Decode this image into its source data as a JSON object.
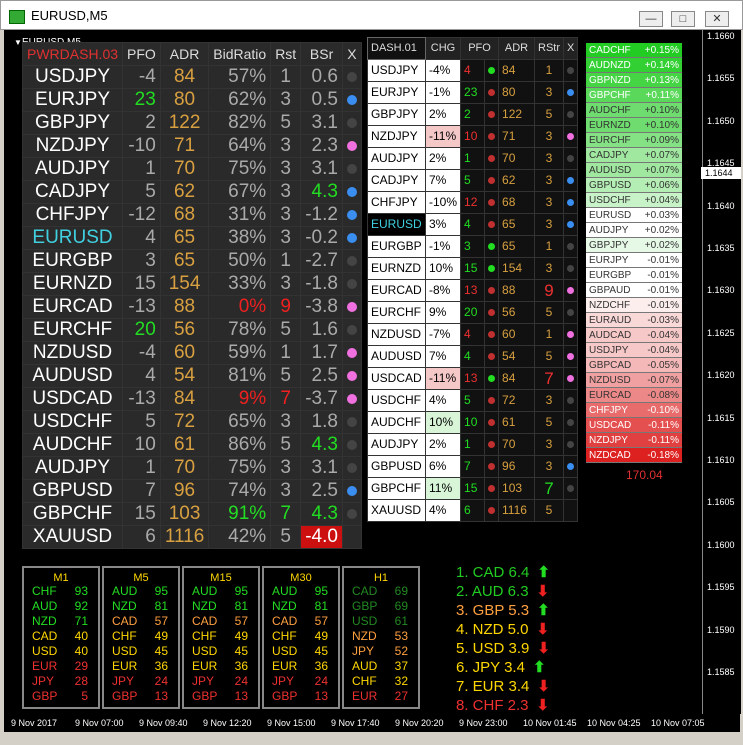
{
  "window": {
    "title": "EURUSD,M5",
    "chart_name": "EURUSD,M5"
  },
  "dash1": {
    "title": "PWRDASH.03",
    "headers": [
      "PFO",
      "ADR",
      "BidRatio",
      "Rst",
      "BSr",
      "X"
    ],
    "rows": [
      {
        "sym": "USDJPY",
        "pfo": "-4",
        "adr": "84",
        "bid": "57%",
        "rst": "1",
        "bsr": "0.6",
        "dot": "gray"
      },
      {
        "sym": "EURJPY",
        "pfo": "23",
        "pfo_color": "#22dd22",
        "adr": "80",
        "bid": "62%",
        "rst": "3",
        "bsr": "0.5",
        "dot": "blue"
      },
      {
        "sym": "GBPJPY",
        "pfo": "2",
        "adr": "122",
        "bid": "82%",
        "rst": "5",
        "bsr": "3.1",
        "dot": "gray"
      },
      {
        "sym": "NZDJPY",
        "pfo": "-10",
        "adr": "71",
        "bid": "64%",
        "rst": "3",
        "bsr": "2.3",
        "dot": "pink"
      },
      {
        "sym": "AUDJPY",
        "pfo": "1",
        "adr": "70",
        "bid": "75%",
        "rst": "3",
        "bsr": "3.1",
        "dot": "gray"
      },
      {
        "sym": "CADJPY",
        "pfo": "5",
        "adr": "62",
        "bid": "67%",
        "rst": "3",
        "bsr": "4.3",
        "bsr_color": "#22dd22",
        "dot": "blue"
      },
      {
        "sym": "CHFJPY",
        "pfo": "-12",
        "adr": "68",
        "bid": "31%",
        "rst": "3",
        "bsr": "-1.2",
        "dot": "blue"
      },
      {
        "sym": "EURUSD",
        "sym_color": "#40d0e0",
        "pfo": "4",
        "adr": "65",
        "bid": "38%",
        "rst": "3",
        "bsr": "-0.2",
        "dot": "blue"
      },
      {
        "sym": "EURGBP",
        "pfo": "3",
        "adr": "65",
        "bid": "50%",
        "rst": "1",
        "bsr": "-2.7",
        "dot": "gray"
      },
      {
        "sym": "EURNZD",
        "pfo": "15",
        "adr": "154",
        "bid": "33%",
        "rst": "3",
        "bsr": "-1.8",
        "dot": "gray"
      },
      {
        "sym": "EURCAD",
        "pfo": "-13",
        "adr": "88",
        "bid": "0%",
        "bid_color": "#ee2020",
        "rst": "9",
        "rst_color": "#ee2020",
        "bsr": "-3.8",
        "dot": "pink"
      },
      {
        "sym": "EURCHF",
        "pfo": "20",
        "pfo_color": "#22dd22",
        "adr": "56",
        "bid": "78%",
        "rst": "5",
        "bsr": "1.6",
        "dot": "gray"
      },
      {
        "sym": "NZDUSD",
        "pfo": "-4",
        "adr": "60",
        "bid": "59%",
        "rst": "1",
        "bsr": "1.7",
        "dot": "pink"
      },
      {
        "sym": "AUDUSD",
        "pfo": "4",
        "adr": "54",
        "bid": "81%",
        "rst": "5",
        "bsr": "2.5",
        "dot": "pink"
      },
      {
        "sym": "USDCAD",
        "pfo": "-13",
        "adr": "84",
        "bid": "9%",
        "bid_color": "#ee2020",
        "rst": "7",
        "rst_color": "#ee2020",
        "bsr": "-3.7",
        "dot": "pink"
      },
      {
        "sym": "USDCHF",
        "pfo": "5",
        "adr": "72",
        "bid": "65%",
        "rst": "3",
        "bsr": "1.8",
        "dot": "gray"
      },
      {
        "sym": "AUDCHF",
        "pfo": "10",
        "adr": "61",
        "bid": "86%",
        "rst": "5",
        "bsr": "4.3",
        "bsr_color": "#22dd22",
        "dot": "gray"
      },
      {
        "sym": "AUDJPY",
        "pfo": "1",
        "adr": "70",
        "bid": "75%",
        "rst": "3",
        "bsr": "3.1",
        "dot": "gray"
      },
      {
        "sym": "GBPUSD",
        "pfo": "7",
        "adr": "96",
        "bid": "74%",
        "rst": "3",
        "bsr": "2.5",
        "dot": "blue"
      },
      {
        "sym": "GBPCHF",
        "pfo": "15",
        "adr": "103",
        "bid": "91%",
        "bid_color": "#22dd22",
        "rst": "7",
        "rst_color": "#22dd22",
        "bsr": "4.3",
        "bsr_color": "#22dd22",
        "dot": "gray"
      },
      {
        "sym": "XAUUSD",
        "pfo": "6",
        "adr": "1116",
        "bid": "42%",
        "rst": "5",
        "bsr": "-4.0",
        "bsr_color": "#ffffff",
        "bsr_bg": "#cc1010",
        "dot": "none"
      }
    ]
  },
  "dash2": {
    "title": "DASH.01",
    "headers": [
      "CHG",
      "PFO",
      "ADR",
      "RStr",
      "X"
    ],
    "rows": [
      {
        "sym": "USDJPY",
        "chg": "-4%",
        "pfo": "4",
        "pc": "#ee3030",
        "d": "green",
        "adr": "84",
        "rst": "1",
        "x": "gray"
      },
      {
        "sym": "EURJPY",
        "chg": "-1%",
        "pfo": "23",
        "pc": "#22dd22",
        "d": "red",
        "adr": "80",
        "rst": "3",
        "x": "blue"
      },
      {
        "sym": "GBPJPY",
        "chg": "2%",
        "pfo": "2",
        "pc": "#22dd22",
        "d": "red",
        "adr": "122",
        "rst": "5",
        "x": "gray"
      },
      {
        "sym": "NZDJPY",
        "chg": "-11%",
        "chg_bg": "#f5c8c8",
        "pfo": "10",
        "pc": "#ee3030",
        "d": "red",
        "adr": "71",
        "rst": "3",
        "x": "pink"
      },
      {
        "sym": "AUDJPY",
        "chg": "2%",
        "pfo": "1",
        "pc": "#22dd22",
        "d": "red",
        "adr": "70",
        "rst": "3",
        "x": "gray"
      },
      {
        "sym": "CADJPY",
        "chg": "7%",
        "pfo": "5",
        "pc": "#22dd22",
        "d": "red",
        "adr": "62",
        "rst": "3",
        "x": "blue"
      },
      {
        "sym": "CHFJPY",
        "chg": "-10%",
        "pfo": "12",
        "pc": "#ee3030",
        "d": "red",
        "adr": "68",
        "rst": "3",
        "x": "blue"
      },
      {
        "sym": "EURUSD",
        "sym_color": "#40d0e0",
        "sym_bg": "#000",
        "chg": "3%",
        "pfo": "4",
        "pc": "#22dd22",
        "d": "red",
        "adr": "65",
        "rst": "3",
        "x": "blue"
      },
      {
        "sym": "EURGBP",
        "chg": "-1%",
        "pfo": "3",
        "pc": "#22dd22",
        "d": "green",
        "adr": "65",
        "rst": "1",
        "x": "gray"
      },
      {
        "sym": "EURNZD",
        "chg": "10%",
        "pfo": "15",
        "pc": "#22dd22",
        "d": "green",
        "adr": "154",
        "rst": "3",
        "x": "gray"
      },
      {
        "sym": "EURCAD",
        "chg": "-8%",
        "pfo": "13",
        "pc": "#ee3030",
        "d": "red",
        "adr": "88",
        "rst": "9",
        "rst_color": "#ee3030",
        "x": "pink"
      },
      {
        "sym": "EURCHF",
        "chg": "9%",
        "pfo": "20",
        "pc": "#22dd22",
        "d": "red",
        "adr": "56",
        "rst": "5",
        "x": "gray"
      },
      {
        "sym": "NZDUSD",
        "chg": "-7%",
        "pfo": "4",
        "pc": "#ee3030",
        "d": "red",
        "adr": "60",
        "rst": "1",
        "x": "pink"
      },
      {
        "sym": "AUDUSD",
        "chg": "7%",
        "pfo": "4",
        "pc": "#22dd22",
        "d": "red",
        "adr": "54",
        "rst": "5",
        "x": "pink"
      },
      {
        "sym": "USDCAD",
        "chg": "-11%",
        "chg_bg": "#f5c8c8",
        "pfo": "13",
        "pc": "#ee3030",
        "d": "green",
        "adr": "84",
        "rst": "7",
        "rst_color": "#ee3030",
        "x": "pink"
      },
      {
        "sym": "USDCHF",
        "chg": "4%",
        "pfo": "5",
        "pc": "#22dd22",
        "d": "red",
        "adr": "72",
        "rst": "3",
        "x": "gray"
      },
      {
        "sym": "AUDCHF",
        "chg": "10%",
        "chg_bg": "#d8f5d8",
        "pfo": "10",
        "pc": "#22dd22",
        "d": "red",
        "adr": "61",
        "rst": "5",
        "x": "gray"
      },
      {
        "sym": "AUDJPY",
        "chg": "2%",
        "pfo": "1",
        "pc": "#22dd22",
        "d": "red",
        "adr": "70",
        "rst": "3",
        "x": "gray"
      },
      {
        "sym": "GBPUSD",
        "chg": "6%",
        "pfo": "7",
        "pc": "#22dd22",
        "d": "red",
        "adr": "96",
        "rst": "3",
        "x": "blue"
      },
      {
        "sym": "GBPCHF",
        "chg": "11%",
        "chg_bg": "#d8f5d8",
        "pfo": "15",
        "pc": "#22dd22",
        "d": "red",
        "adr": "103",
        "rst": "7",
        "rst_color": "#22dd22",
        "x": "gray"
      },
      {
        "sym": "XAUUSD",
        "chg": "4%",
        "pfo": "6",
        "pc": "#22dd22",
        "d": "red",
        "adr": "1116",
        "rst": "5",
        "x": "none"
      }
    ]
  },
  "strength": {
    "rows": [
      {
        "n": "CADCHF",
        "v": "+0.15%",
        "bg": "#22cc22",
        "c": "#fff"
      },
      {
        "n": "AUDNZD",
        "v": "+0.14%",
        "bg": "#33d033",
        "c": "#fff"
      },
      {
        "n": "GBPNZD",
        "v": "+0.13%",
        "bg": "#44d444",
        "c": "#fff"
      },
      {
        "n": "GBPCHF",
        "v": "+0.11%",
        "bg": "#5ad85a",
        "c": "#fff"
      },
      {
        "n": "AUDCHF",
        "v": "+0.10%",
        "bg": "#6edc6e",
        "c": "#333"
      },
      {
        "n": "EURNZD",
        "v": "+0.10%",
        "bg": "#6edc6e",
        "c": "#333"
      },
      {
        "n": "EURCHF",
        "v": "+0.09%",
        "bg": "#84e284",
        "c": "#333"
      },
      {
        "n": "CADJPY",
        "v": "+0.07%",
        "bg": "#a0e8a0",
        "c": "#333"
      },
      {
        "n": "AUDUSD",
        "v": "+0.07%",
        "bg": "#a0e8a0",
        "c": "#333"
      },
      {
        "n": "GBPUSD",
        "v": "+0.06%",
        "bg": "#b4eeb4",
        "c": "#333"
      },
      {
        "n": "USDCHF",
        "v": "+0.04%",
        "bg": "#c8f2c8",
        "c": "#333"
      },
      {
        "n": "EURUSD",
        "v": "+0.03%",
        "bg": "#ffffff",
        "c": "#333"
      },
      {
        "n": "AUDJPY",
        "v": "+0.02%",
        "bg": "#ffffff",
        "c": "#333"
      },
      {
        "n": "GBPJPY",
        "v": "+0.02%",
        "bg": "#e6f8e6",
        "c": "#333"
      },
      {
        "n": "EURJPY",
        "v": "-0.01%",
        "bg": "#ffffff",
        "c": "#333"
      },
      {
        "n": "EURGBP",
        "v": "-0.01%",
        "bg": "#ffffff",
        "c": "#333"
      },
      {
        "n": "GBPAUD",
        "v": "-0.01%",
        "bg": "#ffffff",
        "c": "#333"
      },
      {
        "n": "NZDCHF",
        "v": "-0.01%",
        "bg": "#fdeeee",
        "c": "#333"
      },
      {
        "n": "EURAUD",
        "v": "-0.03%",
        "bg": "#f9d8d8",
        "c": "#333"
      },
      {
        "n": "AUDCAD",
        "v": "-0.04%",
        "bg": "#f7c8c8",
        "c": "#333"
      },
      {
        "n": "USDJPY",
        "v": "-0.04%",
        "bg": "#f7c8c8",
        "c": "#333"
      },
      {
        "n": "GBPCAD",
        "v": "-0.05%",
        "bg": "#f4b8b8",
        "c": "#333"
      },
      {
        "n": "NZDUSD",
        "v": "-0.07%",
        "bg": "#f0a0a0",
        "c": "#333"
      },
      {
        "n": "EURCAD",
        "v": "-0.08%",
        "bg": "#ec8888",
        "c": "#333"
      },
      {
        "n": "CHFJPY",
        "v": "-0.10%",
        "bg": "#e86c6c",
        "c": "#fff"
      },
      {
        "n": "USDCAD",
        "v": "-0.11%",
        "bg": "#e45050",
        "c": "#fff"
      },
      {
        "n": "NZDJPY",
        "v": "-0.11%",
        "bg": "#e04040",
        "c": "#fff"
      },
      {
        "n": "NZDCAD",
        "v": "-0.18%",
        "bg": "#dd2020",
        "c": "#fff"
      }
    ],
    "footer": "170.04"
  },
  "timeframes": [
    {
      "tf": "M1",
      "rows": [
        [
          "CHF",
          "93",
          "#22dd22"
        ],
        [
          "AUD",
          "92",
          "#22dd22"
        ],
        [
          "NZD",
          "71",
          "#22dd22"
        ],
        [
          "CAD",
          "40",
          "#ffd700"
        ],
        [
          "USD",
          "40",
          "#ffd700"
        ],
        [
          "EUR",
          "29",
          "#ee3030"
        ],
        [
          "JPY",
          "28",
          "#ee3030"
        ],
        [
          "GBP",
          "5",
          "#ee3030"
        ]
      ]
    },
    {
      "tf": "M5",
      "rows": [
        [
          "AUD",
          "95",
          "#22dd22"
        ],
        [
          "NZD",
          "81",
          "#22dd22"
        ],
        [
          "CAD",
          "57",
          "#ffa040"
        ],
        [
          "CHF",
          "49",
          "#ffd700"
        ],
        [
          "USD",
          "45",
          "#ffd700"
        ],
        [
          "EUR",
          "36",
          "#ffd700"
        ],
        [
          "JPY",
          "24",
          "#ee3030"
        ],
        [
          "GBP",
          "13",
          "#ee3030"
        ]
      ]
    },
    {
      "tf": "M15",
      "rows": [
        [
          "AUD",
          "95",
          "#22dd22"
        ],
        [
          "NZD",
          "81",
          "#22dd22"
        ],
        [
          "CAD",
          "57",
          "#ffa040"
        ],
        [
          "CHF",
          "49",
          "#ffd700"
        ],
        [
          "USD",
          "45",
          "#ffd700"
        ],
        [
          "EUR",
          "36",
          "#ffd700"
        ],
        [
          "JPY",
          "24",
          "#ee3030"
        ],
        [
          "GBP",
          "13",
          "#ee3030"
        ]
      ]
    },
    {
      "tf": "M30",
      "rows": [
        [
          "AUD",
          "95",
          "#22dd22"
        ],
        [
          "NZD",
          "81",
          "#22dd22"
        ],
        [
          "CAD",
          "57",
          "#ffa040"
        ],
        [
          "CHF",
          "49",
          "#ffd700"
        ],
        [
          "USD",
          "45",
          "#ffd700"
        ],
        [
          "EUR",
          "36",
          "#ffd700"
        ],
        [
          "JPY",
          "24",
          "#ee3030"
        ],
        [
          "GBP",
          "13",
          "#ee3030"
        ]
      ]
    },
    {
      "tf": "H1",
      "rows": [
        [
          "CAD",
          "69",
          "#228822"
        ],
        [
          "GBP",
          "69",
          "#228822"
        ],
        [
          "USD",
          "61",
          "#228822"
        ],
        [
          "NZD",
          "53",
          "#ffa040"
        ],
        [
          "JPY",
          "52",
          "#ffa040"
        ],
        [
          "AUD",
          "37",
          "#ffd700"
        ],
        [
          "CHF",
          "32",
          "#ffd700"
        ],
        [
          "EUR",
          "27",
          "#ee3030"
        ]
      ]
    }
  ],
  "ranking": [
    {
      "t": "1. CAD 6.4",
      "c": "#22cc22",
      "a": "up"
    },
    {
      "t": "2. AUD 6.3",
      "c": "#22cc22",
      "a": "down"
    },
    {
      "t": "3. GBP 5.3",
      "c": "#ffa040",
      "a": "up"
    },
    {
      "t": "4. NZD 5.0",
      "c": "#ffd700",
      "a": "down"
    },
    {
      "t": "5. USD 3.9",
      "c": "#ffd700",
      "a": "down"
    },
    {
      "t": "6. JPY 3.4",
      "c": "#ffd700",
      "a": "up"
    },
    {
      "t": "7. EUR 3.4",
      "c": "#ffd700",
      "a": "down"
    },
    {
      "t": "8. CHF 2.3",
      "c": "#ee3030",
      "a": "down"
    }
  ],
  "y_axis": {
    "ticks": [
      "1.1660",
      "1.1655",
      "1.1650",
      "1.1645",
      "1.1640",
      "1.1635",
      "1.1630",
      "1.1625",
      "1.1620",
      "1.1615",
      "1.1610",
      "1.1605",
      "1.1600",
      "1.1595",
      "1.1590",
      "1.1585"
    ],
    "current": "1.1644"
  },
  "x_axis": {
    "ticks": [
      "9 Nov 2017",
      "9 Nov 07:00",
      "9 Nov 09:40",
      "9 Nov 12:20",
      "9 Nov 15:00",
      "9 Nov 17:40",
      "9 Nov 20:20",
      "9 Nov 23:00",
      "10 Nov 01:45",
      "10 Nov 04:25",
      "10 Nov 07:05"
    ]
  },
  "colors": {
    "up_arrow": "#22dd22",
    "down_arrow": "#ee2020"
  }
}
